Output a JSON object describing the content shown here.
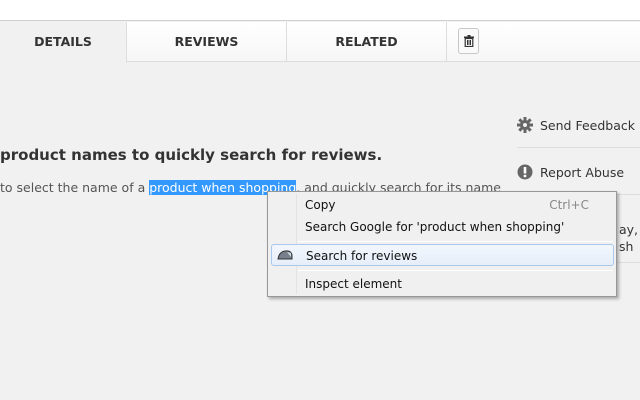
{
  "tabs": [
    {
      "label": "DETAILS",
      "active": true
    },
    {
      "label": "REVIEWS"
    },
    {
      "label": "RELATED"
    }
  ],
  "trash_icon": "trash-icon",
  "main": {
    "heading": "product names to quickly search for reviews.",
    "desc_before": "to select the name of a",
    "desc_selected": "product when shopping",
    "desc_after": ", and quickly search for its name"
  },
  "sidebar": {
    "send_feedback": "Send Feedback",
    "report_abuse": "Report Abuse",
    "partial1": "ay, C",
    "partial2": "sh"
  },
  "context_menu": {
    "items": [
      {
        "label": "Copy",
        "shortcut": "Ctrl+C"
      },
      {
        "label": "Search Google for 'product when shopping'"
      },
      {
        "label": "Search for reviews",
        "icon": "extension-icon",
        "highlighted": true
      },
      {
        "label": "Inspect element"
      }
    ]
  },
  "colors": {
    "selection": "#3399ff"
  }
}
